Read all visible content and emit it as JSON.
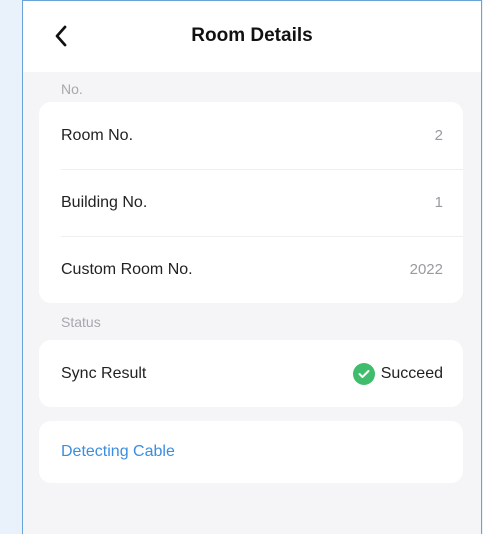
{
  "header": {
    "title": "Room Details"
  },
  "sections": {
    "number": {
      "label": "No.",
      "rows": [
        {
          "label": "Room No.",
          "value": "2"
        },
        {
          "label": "Building No.",
          "value": "1"
        },
        {
          "label": "Custom Room No.",
          "value": "2022"
        }
      ]
    },
    "status": {
      "label": "Status",
      "sync_label": "Sync Result",
      "sync_value": "Succeed"
    }
  },
  "actions": {
    "detect_cable": "Detecting Cable"
  },
  "colors": {
    "success": "#3fbc6c",
    "link": "#3a8ee0"
  }
}
